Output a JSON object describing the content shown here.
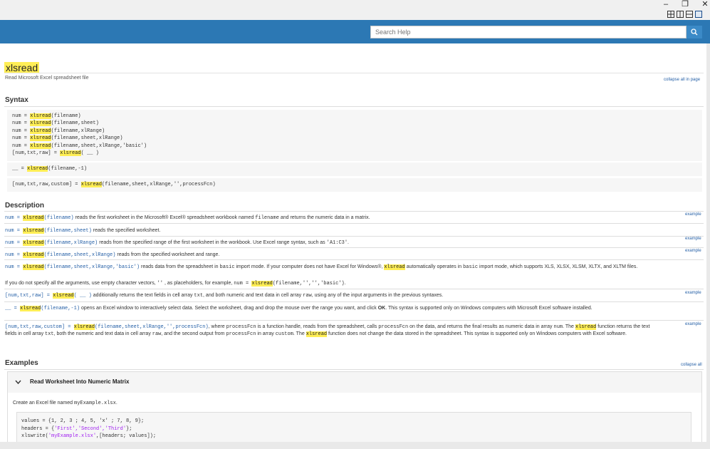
{
  "window": {
    "controls": {
      "minimize": "–",
      "restore": "❐",
      "close": "✕"
    },
    "layout_buttons": [
      "layout-grid",
      "layout-columns",
      "layout-rows",
      "layout-single"
    ]
  },
  "search": {
    "placeholder": "Search Help",
    "icon": "search-icon"
  },
  "page": {
    "function_name": "xlsread",
    "purpose": "Read Microsoft Excel spreadsheet file",
    "collapse_all_in_page": "collapse all in page"
  },
  "syntax": {
    "heading": "Syntax",
    "block1": [
      [
        "num = ",
        "xlsread",
        "(filename)"
      ],
      [
        "num = ",
        "xlsread",
        "(filename,sheet)"
      ],
      [
        "num = ",
        "xlsread",
        "(filename,xlRange)"
      ],
      [
        "num = ",
        "xlsread",
        "(filename,sheet,xlRange)"
      ],
      [
        "num = ",
        "xlsread",
        "(filename,sheet,xlRange,'basic')"
      ],
      [
        "[num,txt,raw] = ",
        "xlsread",
        "( __ )"
      ]
    ],
    "block2": [
      [
        "__ = ",
        "xlsread",
        "(filename,-1)"
      ]
    ],
    "block3": [
      [
        "[num,txt,raw,custom] = ",
        "xlsread",
        "(filename,sheet,xlRange,'',processFcn)"
      ]
    ]
  },
  "description": {
    "heading": "Description",
    "example_label": "example",
    "d1": {
      "pre": "num = ",
      "fn": "xlsread",
      "args": "(filename)",
      "text": " reads the first worksheet in the Microsoft® Excel® spreadsheet workbook named ",
      "code": "filename",
      "text2": " and returns the numeric data in a matrix."
    },
    "d2": {
      "pre": "num = ",
      "fn": "xlsread",
      "args": "(filename,sheet)",
      "text": " reads the specified worksheet."
    },
    "d3": {
      "pre": "num = ",
      "fn": "xlsread",
      "args": "(filename,xlRange)",
      "text": " reads from the specified range of the first worksheet in the workbook. Use Excel range syntax, such as ",
      "code": "'A1:C3'",
      "text2": "."
    },
    "d4": {
      "pre": "num = ",
      "fn": "xlsread",
      "args": "(filename,sheet,xlRange)",
      "text": " reads from the specified worksheet and range."
    },
    "d5": {
      "pre": "num = ",
      "fn": "xlsread",
      "args": "(filename,sheet,xlRange,'basic')",
      "text": " reads data from the spreadsheet in ",
      "code": "basic",
      "text2": " import mode. If your computer does not have Excel for Windows®, ",
      "fn2": "xlsread",
      "text3": " automatically operates in ",
      "code2": "basic",
      "text4": " import mode, which supports XLS, XLSX, XLSM, XLTX, and XLTM files."
    },
    "d5b": {
      "text": "If you do not specify all the arguments, use empty character vectors, ",
      "code": "''",
      "text2": " , as placeholders, for example, ",
      "code2": "num = ",
      "fn": "xlsread",
      "code3": "(filename,'','','basic')",
      "text3": "."
    },
    "d6": {
      "pre": "[num,txt,raw] = ",
      "fn": "xlsread",
      "args": "( __ )",
      "text": " additionally returns the text fields in cell array ",
      "code": "txt",
      "text2": ", and both numeric and text data in cell array ",
      "code2": "raw",
      "text3": ", using any of the input arguments in the previous syntaxes."
    },
    "d7": {
      "pre": "__ = ",
      "fn": "xlsread",
      "args": "(filename,-1)",
      "text": " opens an Excel window to interactively select data. Select the worksheet, drag and drop the mouse over the range you want, and click ",
      "bold": "OK",
      "text2": ". This syntax is supported only on Windows computers with Microsoft Excel software installed."
    },
    "d8": {
      "pre": "[num,txt,raw,custom] = ",
      "fn": "xlsread",
      "args": "(filename,sheet,xlRange,'',processFcn)",
      "text": ", where ",
      "code": "processFcn",
      "text2": " is a function handle, reads from the spreadsheet, calls ",
      "code2": "processFcn",
      "text3": " on the data, and returns the final results as numeric data in array ",
      "code3": "num",
      "text4": ". The ",
      "fn2": "xlsread",
      "text5": " function returns the text fields in cell array ",
      "code4": "txt",
      "text6": ", both the numeric and text data in cell array ",
      "code5": "raw",
      "text7": ", and the second output from ",
      "code6": "processFcn",
      "text8": " in array ",
      "code7": "custom",
      "text9": ". The ",
      "fn3": "xlsread",
      "text10": " function does not change the data stored in the spreadsheet. This syntax is supported only on Windows computers with Excel software."
    }
  },
  "examples": {
    "heading": "Examples",
    "collapse_all": "collapse all",
    "example1_title": "Read Worksheet Into Numeric Matrix",
    "intro_text": "Create an Excel file named ",
    "intro_code": "myExample.xlsx",
    "intro_end": ".",
    "code_line1": "values = {1, 2, 3 ; 4, 5, 'x' ; 7, 8, 9};",
    "code_line2a": "headers = {",
    "code_line2b": "'First','Second','Third'",
    "code_line2c": "};",
    "code_line3a": "xlswrite(",
    "code_line3b": "'myExample.xlsx'",
    "code_line3c": ",[headers; values]);"
  }
}
